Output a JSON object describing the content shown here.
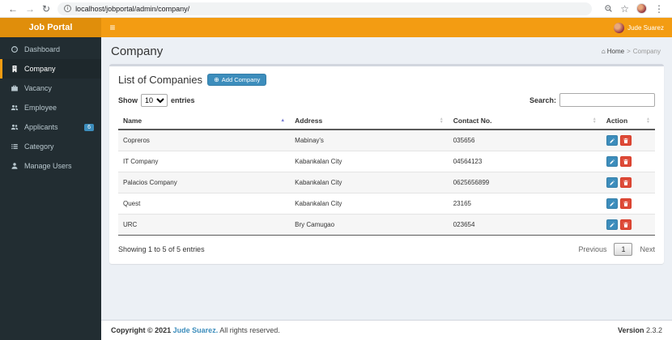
{
  "browser": {
    "url": "localhost/jobportal/admin/company/"
  },
  "icons": {
    "back": "←",
    "forward": "→",
    "reload": "↻",
    "info": "i",
    "bookmark_star": "☆",
    "menu_dots": "⋮",
    "hamburger": "≡",
    "home_glyph": "⌂",
    "breadcrumb_separator": ">",
    "add_plus": "⊕",
    "sort_asc": "▲",
    "sort_up": "▲",
    "sort_down": "▼"
  },
  "navbar": {
    "brand": "Job Portal",
    "user_name": "Jude Suarez"
  },
  "sidebar": {
    "items": [
      {
        "label": "Dashboard",
        "icon": "dashboard-icon"
      },
      {
        "label": "Company",
        "icon": "building-icon",
        "active": true
      },
      {
        "label": "Vacancy",
        "icon": "briefcase-icon"
      },
      {
        "label": "Employee",
        "icon": "users-icon"
      },
      {
        "label": "Applicants",
        "icon": "users-icon",
        "badge": "6"
      },
      {
        "label": "Category",
        "icon": "list-icon"
      },
      {
        "label": "Manage Users",
        "icon": "user-icon"
      }
    ]
  },
  "content": {
    "page_title": "Company",
    "breadcrumb": {
      "home": "Home",
      "current": "Company"
    },
    "box": {
      "title": "List of Companies",
      "add_button_label": "Add Company",
      "controls": {
        "show_label": "Show",
        "page_length": "10",
        "entries_label": "entries",
        "search_label": "Search:",
        "search_value": ""
      },
      "table": {
        "headers": [
          "Name",
          "Address",
          "Contact No.",
          "Action"
        ],
        "rows": [
          {
            "name": "Copreros",
            "address": "Mabinay's",
            "contact": "035656"
          },
          {
            "name": "IT Company",
            "address": "Kabankalan City",
            "contact": "04564123"
          },
          {
            "name": "Palacios Company",
            "address": "Kabankalan City",
            "contact": "0625656899"
          },
          {
            "name": "Quest",
            "address": "Kabankalan City",
            "contact": "23165"
          },
          {
            "name": "URC",
            "address": "Bry Camugao",
            "contact": "023654"
          }
        ]
      },
      "info_text": "Showing 1 to 5 of 5 entries",
      "pagination": {
        "previous": "Previous",
        "page": "1",
        "next": "Next"
      }
    }
  },
  "footer": {
    "copyright": "Copyright © 2021",
    "author": "Jude Suarez.",
    "rights": "All rights reserved.",
    "version_label": "Version",
    "version_value": "2.3.2"
  },
  "colors": {
    "navbar_orange": "#f39c12",
    "brand_orange": "#e08e0b",
    "sidebar_dark": "#222d32",
    "primary_blue": "#3c8dbc",
    "danger_red": "#dd4b39",
    "content_bg": "#ecf0f5"
  }
}
